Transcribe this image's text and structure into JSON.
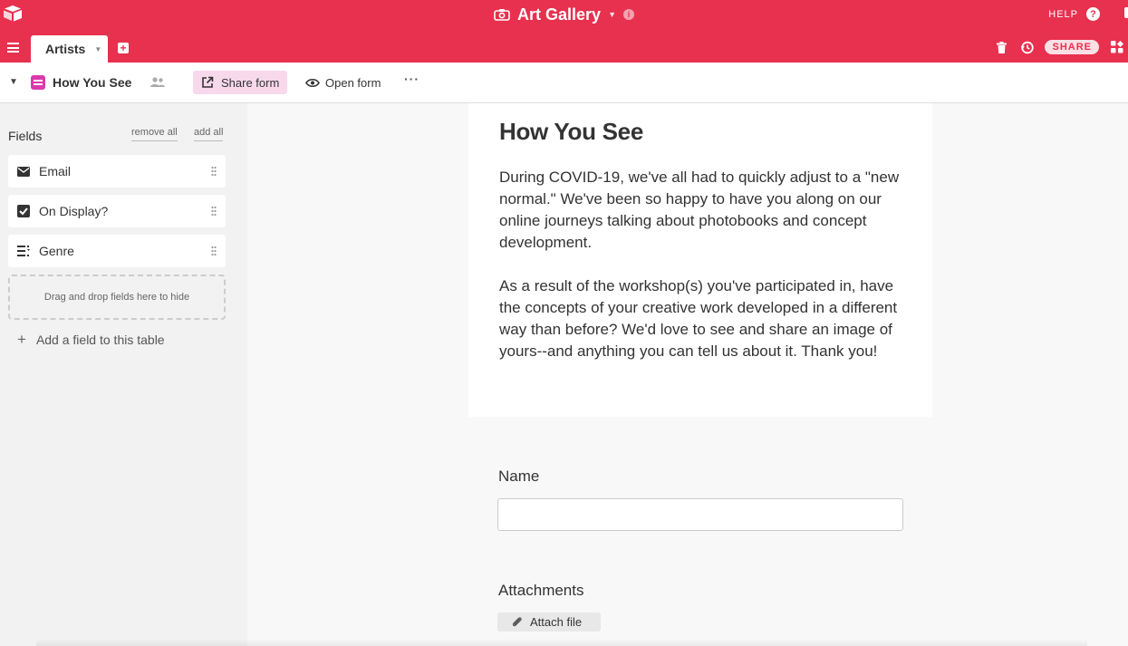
{
  "header": {
    "base_name": "Art Gallery",
    "help_label": "HELP",
    "help_icon": "?",
    "info_icon": "i",
    "share_label": "SHARE"
  },
  "tabs": [
    {
      "label": "Artists",
      "active": true
    }
  ],
  "viewbar": {
    "view_name": "How You See",
    "share_form_label": "Share form",
    "open_form_label": "Open form",
    "more_label": "···"
  },
  "sidebar": {
    "fields_label": "Fields",
    "remove_all_label": "remove all",
    "add_all_label": "add all",
    "fields": [
      {
        "label": "Email",
        "icon": "envelope-icon"
      },
      {
        "label": "On Display?",
        "icon": "checkbox-icon"
      },
      {
        "label": "Genre",
        "icon": "multiselect-icon"
      }
    ],
    "drop_zone_text": "Drag and drop fields here to hide",
    "add_field_label": "Add a field to this table"
  },
  "form": {
    "title": "How You See",
    "description_p1": "During COVID-19, we've all had to quickly adjust to a \"new normal.\" We've been so happy to have you along on our online journeys talking about photobooks and concept development.",
    "description_p2": "As a result of the workshop(s) you've participated in, have the concepts of your creative work developed in a different way than before?  We'd love to see and share an image of yours--and anything you can tell us about it. Thank you!",
    "questions": [
      {
        "label": "Name",
        "type": "text",
        "value": ""
      },
      {
        "label": "Attachments",
        "type": "attachment",
        "button_label": "Attach file"
      }
    ]
  },
  "colors": {
    "brand": "#e8304f",
    "form_icon": "#d93aac",
    "share_form_bg": "#f8d9ec"
  }
}
